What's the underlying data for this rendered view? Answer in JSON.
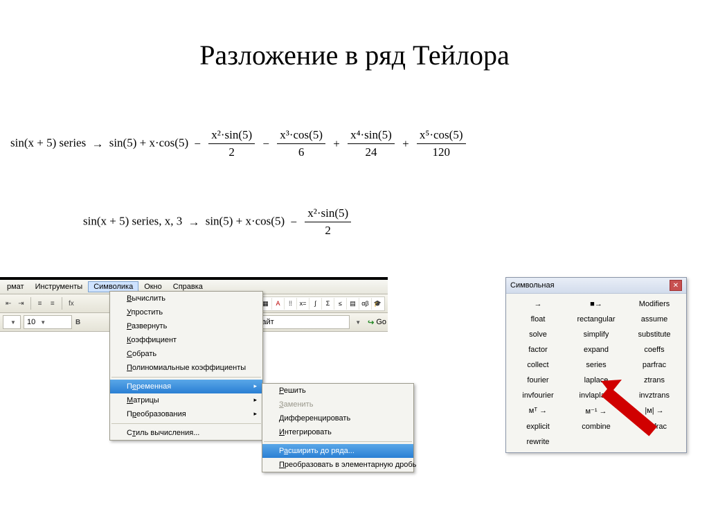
{
  "title": "Разложение в ряд Тейлора",
  "formula1": {
    "lhs": "sin(x + 5)  series",
    "arrow": "→",
    "t1": "sin(5) + x·cos(5)",
    "f1_num": "x²·sin(5)",
    "f1_den": "2",
    "f2_num": "x³·cos(5)",
    "f2_den": "6",
    "f3_num": "x⁴·sin(5)",
    "f3_den": "24",
    "f4_num": "x⁵·cos(5)",
    "f4_den": "120"
  },
  "formula2": {
    "lhs": "sin(x + 5)  series, x, 3",
    "arrow": "→",
    "t1": "sin(5) + x·cos(5)",
    "f1_num": "x²·sin(5)",
    "f1_den": "2"
  },
  "menubar": {
    "items": [
      "рмат",
      "Инструменты",
      "Символика",
      "Окно",
      "Справка"
    ],
    "open_index": 2
  },
  "toolbar2": {
    "size": "10",
    "bold": "B",
    "site_label": "Мой сайт",
    "go": "Go"
  },
  "dropdown1": {
    "items": [
      {
        "label": "Вычислить",
        "u": "В"
      },
      {
        "label": "Упростить",
        "u": "У"
      },
      {
        "label": "Развернуть",
        "u": "Р"
      },
      {
        "label": "Коэффициент",
        "u": "К"
      },
      {
        "label": "Собрать",
        "u": "С"
      },
      {
        "label": "Полиномиальные коэффициенты",
        "u": "П"
      }
    ],
    "items2": [
      {
        "label": "Переменная",
        "u": "е",
        "highlight": true
      },
      {
        "label": "Матрицы",
        "u": "М"
      },
      {
        "label": "Преобразования",
        "u": "р"
      }
    ],
    "items3": [
      {
        "label": "Стиль вычисления...",
        "u": "т"
      }
    ]
  },
  "dropdown2": {
    "items": [
      {
        "label": "Решить",
        "u": "Р"
      },
      {
        "label": "Заменить",
        "u": "З",
        "disabled": true
      },
      {
        "label": "Дифференцировать",
        "u": "Д"
      },
      {
        "label": "Интегрировать",
        "u": "И"
      }
    ],
    "items2": [
      {
        "label": "Расширить до ряда...",
        "u": "а",
        "highlight": true
      },
      {
        "label": "Преобразовать в элементарную дробь",
        "u": "П"
      }
    ]
  },
  "palette": {
    "title": "Символьная",
    "cells": [
      "→",
      "■→",
      "Modifiers",
      "float",
      "rectangular",
      "assume",
      "solve",
      "simplify",
      "substitute",
      "factor",
      "expand",
      "coeffs",
      "collect",
      "series",
      "parfrac",
      "fourier",
      "laplace",
      "ztrans",
      "invfourier",
      "invlaplace",
      "invztrans",
      "мᵀ →",
      "м⁻¹ →",
      "|м| →",
      "explicit",
      "combine",
      "confrac",
      "rewrite",
      "",
      ""
    ]
  }
}
